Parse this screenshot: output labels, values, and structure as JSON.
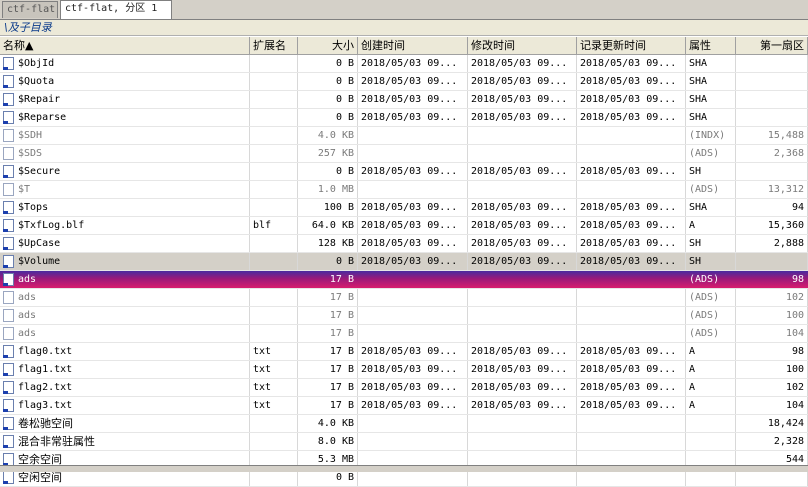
{
  "tabs": [
    {
      "label": "ctf-flat",
      "active": false
    },
    {
      "label": "ctf-flat, 分区 1",
      "active": true
    }
  ],
  "path": "\\及子目录",
  "columns": [
    "名称▲",
    "扩展名",
    "大小",
    "创建时间",
    "修改时间",
    "记录更新时间",
    "属性",
    "第一扇区"
  ],
  "rows": [
    {
      "name": "$ObjId",
      "ext": "",
      "size": "0 B",
      "created": "2018/05/03  09...",
      "modified": "2018/05/03  09...",
      "updated": "2018/05/03  09...",
      "attr": "SHA",
      "sector": "",
      "style": ""
    },
    {
      "name": "$Quota",
      "ext": "",
      "size": "0 B",
      "created": "2018/05/03  09...",
      "modified": "2018/05/03  09...",
      "updated": "2018/05/03  09...",
      "attr": "SHA",
      "sector": "",
      "style": ""
    },
    {
      "name": "$Repair",
      "ext": "",
      "size": "0 B",
      "created": "2018/05/03  09...",
      "modified": "2018/05/03  09...",
      "updated": "2018/05/03  09...",
      "attr": "SHA",
      "sector": "",
      "style": ""
    },
    {
      "name": "$Reparse",
      "ext": "",
      "size": "0 B",
      "created": "2018/05/03  09...",
      "modified": "2018/05/03  09...",
      "updated": "2018/05/03  09...",
      "attr": "SHA",
      "sector": "",
      "style": ""
    },
    {
      "name": "$SDH",
      "ext": "",
      "size": "4.0 KB",
      "created": "",
      "modified": "",
      "updated": "",
      "attr": "(INDX)",
      "sector": "15,488",
      "style": "grey"
    },
    {
      "name": "$SDS",
      "ext": "",
      "size": "257 KB",
      "created": "",
      "modified": "",
      "updated": "",
      "attr": "(ADS)",
      "sector": "2,368",
      "style": "grey"
    },
    {
      "name": "$Secure",
      "ext": "",
      "size": "0 B",
      "created": "2018/05/03  09...",
      "modified": "2018/05/03  09...",
      "updated": "2018/05/03  09...",
      "attr": "SH",
      "sector": "",
      "style": ""
    },
    {
      "name": "$T",
      "ext": "",
      "size": "1.0 MB",
      "created": "",
      "modified": "",
      "updated": "",
      "attr": "(ADS)",
      "sector": "13,312",
      "style": "grey"
    },
    {
      "name": "$Tops",
      "ext": "",
      "size": "100 B",
      "created": "2018/05/03  09...",
      "modified": "2018/05/03  09...",
      "updated": "2018/05/03  09...",
      "attr": "SHA",
      "sector": "94",
      "style": ""
    },
    {
      "name": "$TxfLog.blf",
      "ext": "blf",
      "size": "64.0 KB",
      "created": "2018/05/03  09...",
      "modified": "2018/05/03  09...",
      "updated": "2018/05/03  09...",
      "attr": "A",
      "sector": "15,360",
      "style": ""
    },
    {
      "name": "$UpCase",
      "ext": "",
      "size": "128 KB",
      "created": "2018/05/03  09...",
      "modified": "2018/05/03  09...",
      "updated": "2018/05/03  09...",
      "attr": "SH",
      "sector": "2,888",
      "style": ""
    },
    {
      "name": "$Volume",
      "ext": "",
      "size": "0 B",
      "created": "2018/05/03  09...",
      "modified": "2018/05/03  09...",
      "updated": "2018/05/03  09...",
      "attr": "SH",
      "sector": "",
      "style": "hl-gray"
    },
    {
      "name": "ads",
      "ext": "",
      "size": "17 B",
      "created": "",
      "modified": "",
      "updated": "",
      "attr": "(ADS)",
      "sector": "98",
      "style": "hl-sel"
    },
    {
      "name": "ads",
      "ext": "",
      "size": "17 B",
      "created": "",
      "modified": "",
      "updated": "",
      "attr": "(ADS)",
      "sector": "102",
      "style": "grey"
    },
    {
      "name": "ads",
      "ext": "",
      "size": "17 B",
      "created": "",
      "modified": "",
      "updated": "",
      "attr": "(ADS)",
      "sector": "100",
      "style": "grey"
    },
    {
      "name": "ads",
      "ext": "",
      "size": "17 B",
      "created": "",
      "modified": "",
      "updated": "",
      "attr": "(ADS)",
      "sector": "104",
      "style": "grey"
    },
    {
      "name": "flag0.txt",
      "ext": "txt",
      "size": "17 B",
      "created": "2018/05/03  09...",
      "modified": "2018/05/03  09...",
      "updated": "2018/05/03  09...",
      "attr": "A",
      "sector": "98",
      "style": ""
    },
    {
      "name": "flag1.txt",
      "ext": "txt",
      "size": "17 B",
      "created": "2018/05/03  09...",
      "modified": "2018/05/03  09...",
      "updated": "2018/05/03  09...",
      "attr": "A",
      "sector": "100",
      "style": ""
    },
    {
      "name": "flag2.txt",
      "ext": "txt",
      "size": "17 B",
      "created": "2018/05/03  09...",
      "modified": "2018/05/03  09...",
      "updated": "2018/05/03  09...",
      "attr": "A",
      "sector": "102",
      "style": ""
    },
    {
      "name": "flag3.txt",
      "ext": "txt",
      "size": "17 B",
      "created": "2018/05/03  09...",
      "modified": "2018/05/03  09...",
      "updated": "2018/05/03  09...",
      "attr": "A",
      "sector": "104",
      "style": ""
    },
    {
      "name": "卷松驰空间",
      "ext": "",
      "size": "4.0 KB",
      "created": "",
      "modified": "",
      "updated": "",
      "attr": "",
      "sector": "18,424",
      "style": "cjk"
    },
    {
      "name": "混合非常驻属性",
      "ext": "",
      "size": "8.0 KB",
      "created": "",
      "modified": "",
      "updated": "",
      "attr": "",
      "sector": "2,328",
      "style": "cjk"
    },
    {
      "name": "空余空间",
      "ext": "",
      "size": "5.3 MB",
      "created": "",
      "modified": "",
      "updated": "",
      "attr": "",
      "sector": "544",
      "style": "cjk"
    },
    {
      "name": "空闲空间",
      "ext": "",
      "size": "0 B",
      "created": "",
      "modified": "",
      "updated": "",
      "attr": "",
      "sector": "",
      "style": "cjk"
    }
  ],
  "colors": {
    "selection_start": "#4a2aa0",
    "selection_end": "#d81c6e",
    "header_bg": "#ece9d8"
  }
}
